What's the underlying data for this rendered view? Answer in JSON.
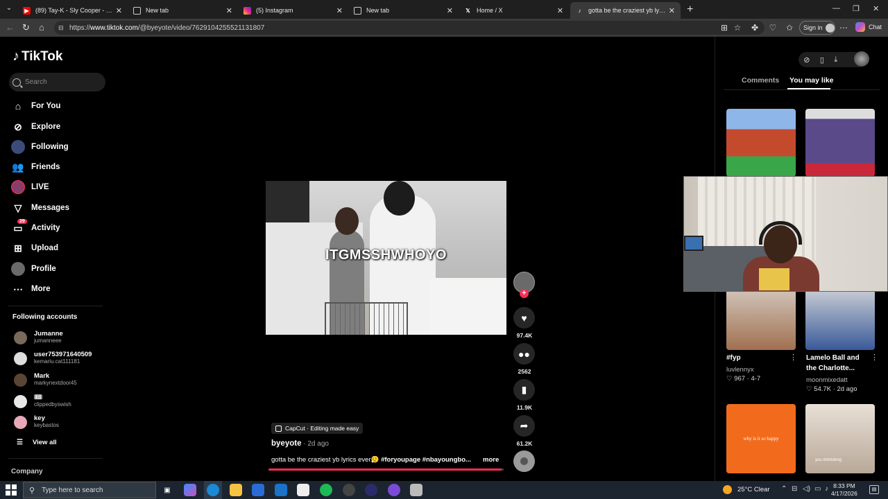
{
  "browser": {
    "tabs": [
      {
        "label": "(89) Tay-K - Sly Cooper - YouTube",
        "icon": "youtube-icon",
        "active": false
      },
      {
        "label": "New tab",
        "icon": "edge-icon",
        "active": false
      },
      {
        "label": "(5) Instagram",
        "icon": "instagram-icon",
        "active": false
      },
      {
        "label": "New tab",
        "icon": "edge-icon",
        "active": false
      },
      {
        "label": "Home / X",
        "icon": "x-icon",
        "active": false
      },
      {
        "label": "gotta be the craziest yb lyrics ever",
        "icon": "tiktok-icon",
        "active": true
      }
    ],
    "url_prefix": "https://",
    "url_host": "www.tiktok.com",
    "url_path": "/@byeyote/video/7629104255521131807",
    "signin_label": "Sign in",
    "chat_label": "Chat"
  },
  "sidebar": {
    "logo": "TikTok",
    "search_placeholder": "Search",
    "nav": [
      {
        "label": "For You",
        "icon": "home-icon"
      },
      {
        "label": "Explore",
        "icon": "compass-icon"
      },
      {
        "label": "Following",
        "icon": "following-avatar-icon"
      },
      {
        "label": "Friends",
        "icon": "friends-icon"
      },
      {
        "label": "LIVE",
        "icon": "live-avatar-icon"
      },
      {
        "label": "Messages",
        "icon": "messages-icon"
      },
      {
        "label": "Activity",
        "icon": "activity-icon",
        "badge": "29"
      },
      {
        "label": "Upload",
        "icon": "upload-icon"
      },
      {
        "label": "Profile",
        "icon": "profile-avatar-icon"
      },
      {
        "label": "More",
        "icon": "more-icon"
      }
    ],
    "following_title": "Following accounts",
    "following": [
      {
        "name": "Jumanne",
        "user": "jumanneee"
      },
      {
        "name": "user753971640509",
        "user": "kemariu.cat111181"
      },
      {
        "name": "Mark",
        "user": "markynextdoor45"
      },
      {
        "name": "🎟",
        "user": "clippedbyswish"
      },
      {
        "name": "key",
        "user": "keybastos"
      }
    ],
    "view_all": "View all",
    "company": "Company"
  },
  "video": {
    "overlay_text": "ITGMSSHWHOYO",
    "capcut_label": "CapCut · Editing made easy",
    "author": "byeyote",
    "post_time": " · 2d ago",
    "caption_text": "gotta be the craziest yb lyrics ever😮‍💨 ",
    "caption_tags": "#foryoupage #nbayoungbo...",
    "more_label": "more",
    "likes": "97.4K",
    "comments": "2562",
    "saves": "11.9K",
    "shares": "61.2K",
    "progress": 0.99
  },
  "right_panel": {
    "tabs": [
      "Comments",
      "You may like"
    ],
    "recs": [
      {
        "title": "#fyp",
        "author": "luvlennyx",
        "likes": "967",
        "date": "4-7"
      },
      {
        "title": "Lamelo Ball and the Charlotte...",
        "author": "moonmixedatt",
        "likes": "54.7K",
        "date": "2d ago"
      }
    ],
    "thumb4_caption": "why is it so happy",
    "thumb5_caption": "you mimicking"
  },
  "taskbar": {
    "search_placeholder": "Type here to search",
    "weather": "25°C  Clear",
    "time": "8:33 PM",
    "date": "4/17/2026"
  },
  "colors": {
    "accent": "#fe2c55",
    "background": "#000000",
    "chrome": "#3a3a3a"
  }
}
